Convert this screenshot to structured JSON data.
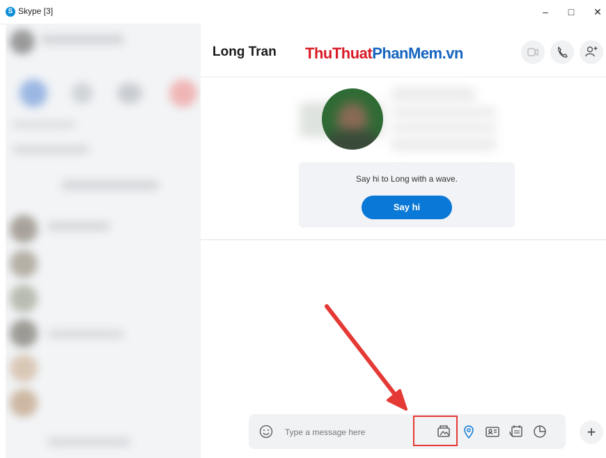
{
  "window": {
    "title": "Skype [3]",
    "logo_letter": "S",
    "minimize": "–",
    "maximize": "□",
    "close": "✕"
  },
  "header": {
    "contact_name": "Long Tran",
    "watermark_part1": "ThuThuat",
    "watermark_part2": "PhanMem.vn"
  },
  "greeting": {
    "text": "Say hi to Long with a wave.",
    "button": "Say hi"
  },
  "composer": {
    "placeholder": "Type a message here"
  },
  "plus_label": "+",
  "colors": {
    "accent": "#0a78d6",
    "highlight": "#e53935",
    "watermark_red": "#d81b27",
    "watermark_blue": "#1565c0"
  }
}
